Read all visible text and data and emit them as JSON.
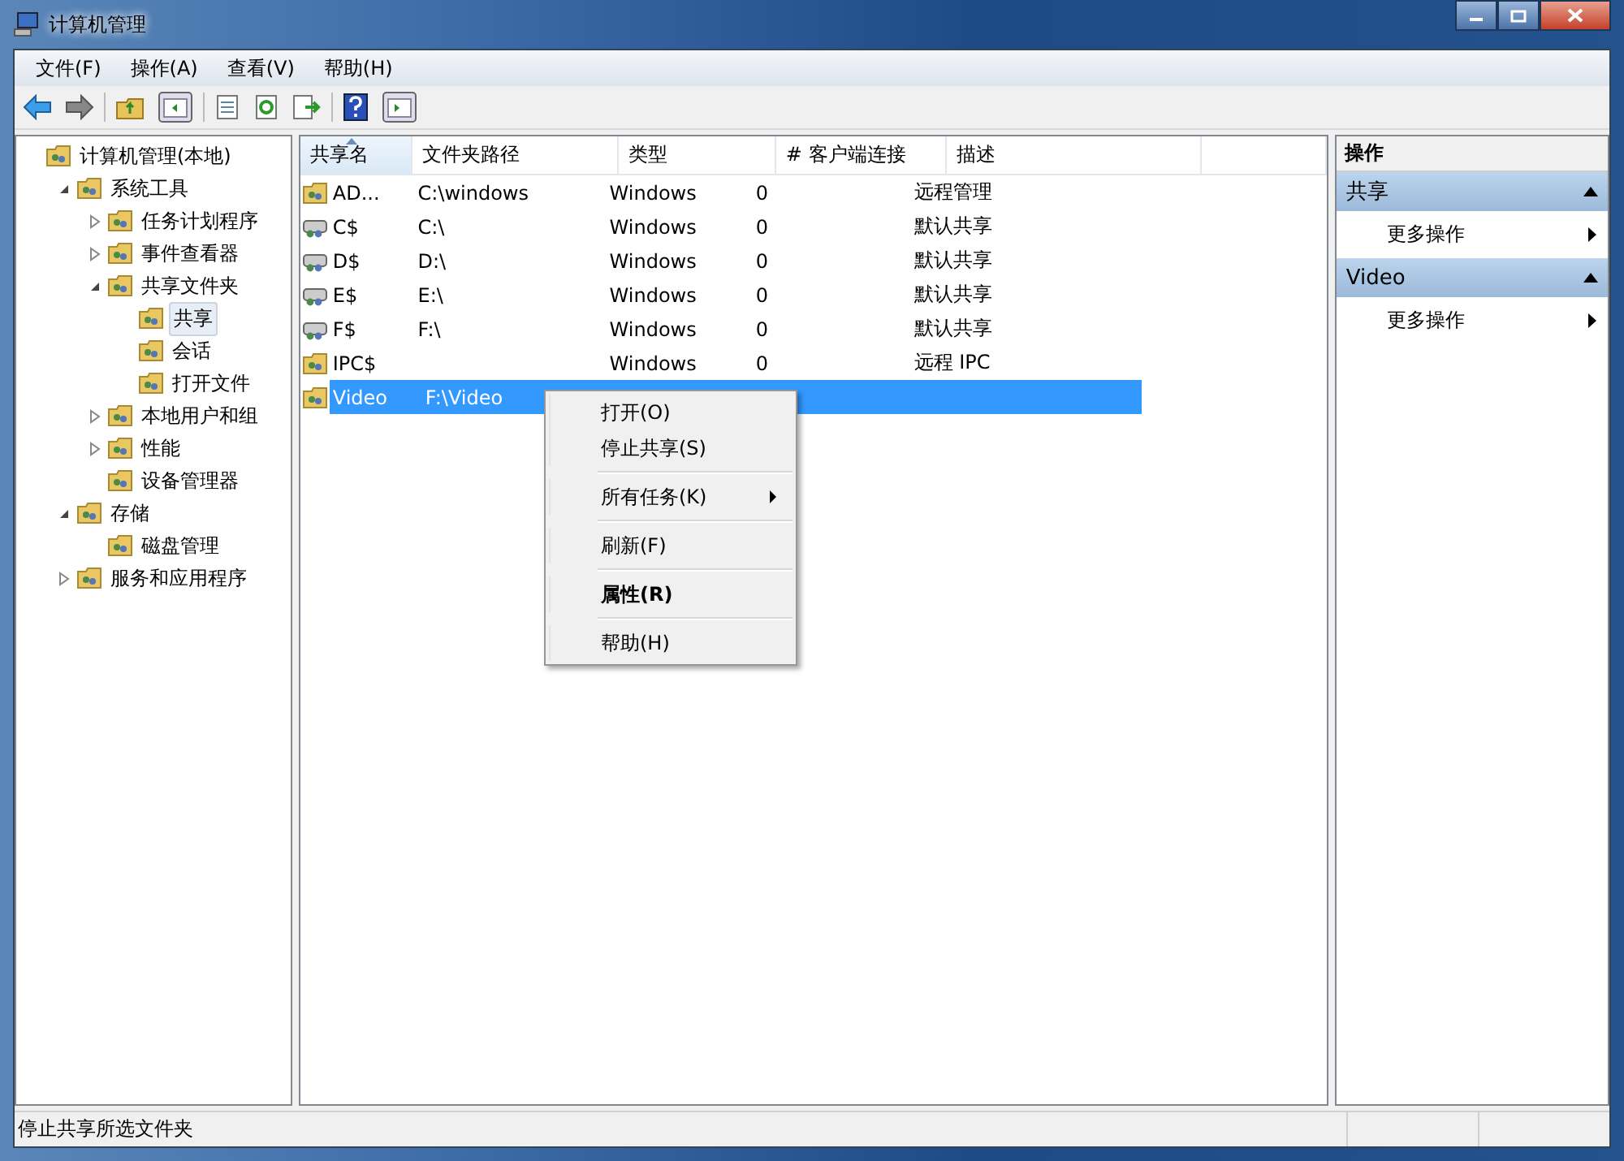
{
  "window": {
    "title": "计算机管理"
  },
  "menu_bar": [
    "文件(F)",
    "操作(A)",
    "查看(V)",
    "帮助(H)"
  ],
  "tree": [
    {
      "label": "计算机管理(本地)",
      "selected": false,
      "children": [
        {
          "label": "系统工具",
          "selected": false,
          "expanded": true,
          "children": [
            {
              "label": "任务计划程序",
              "selected": false,
              "expanded": false
            },
            {
              "label": "事件查看器",
              "selected": false,
              "expanded": false
            },
            {
              "label": "共享文件夹",
              "selected": false,
              "expanded": true,
              "children": [
                {
                  "label": "共享",
                  "selected": true
                },
                {
                  "label": "会话",
                  "selected": false
                },
                {
                  "label": "打开文件",
                  "selected": false
                }
              ]
            },
            {
              "label": "本地用户和组",
              "selected": false,
              "expanded": false
            },
            {
              "label": "性能",
              "selected": false,
              "expanded": false
            },
            {
              "label": "设备管理器",
              "selected": false
            }
          ]
        },
        {
          "label": "存储",
          "selected": false,
          "expanded": true,
          "children": [
            {
              "label": "磁盘管理",
              "selected": false
            }
          ]
        },
        {
          "label": "服务和应用程序",
          "selected": false,
          "expanded": false
        }
      ]
    }
  ],
  "table": {
    "columns": [
      {
        "label": "共享名",
        "sorted": true
      },
      {
        "label": "文件夹路径",
        "sorted": false
      },
      {
        "label": "类型",
        "sorted": false
      },
      {
        "label": "# 客户端连接",
        "sorted": false
      },
      {
        "label": "描述",
        "sorted": false
      }
    ],
    "rows": [
      {
        "cells": [
          "AD...",
          "C:\\windows",
          "Windows",
          "0",
          "远程管理"
        ],
        "selected": false,
        "kind": "folder"
      },
      {
        "cells": [
          "C$",
          "C:\\",
          "Windows",
          "0",
          "默认共享"
        ],
        "selected": false,
        "kind": "drive"
      },
      {
        "cells": [
          "D$",
          "D:\\",
          "Windows",
          "0",
          "默认共享"
        ],
        "selected": false,
        "kind": "drive"
      },
      {
        "cells": [
          "E$",
          "E:\\",
          "Windows",
          "0",
          "默认共享"
        ],
        "selected": false,
        "kind": "drive"
      },
      {
        "cells": [
          "F$",
          "F:\\",
          "Windows",
          "0",
          "默认共享"
        ],
        "selected": false,
        "kind": "drive"
      },
      {
        "cells": [
          "IPC$",
          "",
          "Windows",
          "0",
          "远程 IPC"
        ],
        "selected": false,
        "kind": "folder"
      },
      {
        "cells": [
          "Video",
          "F:\\Video"
        ],
        "selected": true,
        "kind": "folder"
      }
    ]
  },
  "context_menu": [
    {
      "kind": "item",
      "label": "打开(O)",
      "default": false,
      "submenu": false
    },
    {
      "kind": "item",
      "label": "停止共享(S)",
      "default": false,
      "submenu": false
    },
    {
      "kind": "separator"
    },
    {
      "kind": "item",
      "label": "所有任务(K)",
      "default": false,
      "submenu": true
    },
    {
      "kind": "separator"
    },
    {
      "kind": "item",
      "label": "刷新(F)",
      "default": false,
      "submenu": false
    },
    {
      "kind": "separator"
    },
    {
      "kind": "item",
      "label": "属性(R)",
      "default": true,
      "submenu": false
    },
    {
      "kind": "separator"
    },
    {
      "kind": "item",
      "label": "帮助(H)",
      "default": false,
      "submenu": false
    }
  ],
  "actions": {
    "title": "操作",
    "sections": [
      {
        "title": "共享",
        "expanded": true,
        "items": [
          "更多操作"
        ]
      },
      {
        "title": "Video",
        "expanded": true,
        "items": [
          "更多操作"
        ]
      }
    ]
  },
  "status_bar": {
    "text": "停止共享所选文件夹"
  }
}
